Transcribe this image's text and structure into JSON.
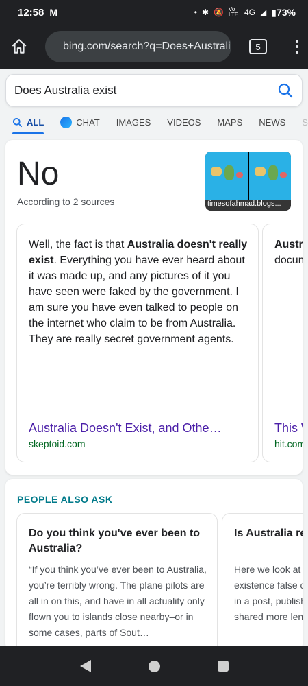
{
  "status_bar": {
    "time": "12:58",
    "notification_icon": "M",
    "network": "4G",
    "volte": "Vo LTE",
    "battery": "73%"
  },
  "browser": {
    "url": "bing.com/search?q=Does+Australia+exist",
    "tab_count": "5"
  },
  "search": {
    "query": "Does Australia exist"
  },
  "scopes": [
    {
      "label": "ALL",
      "active": true
    },
    {
      "label": "CHAT",
      "active": false
    },
    {
      "label": "IMAGES",
      "active": false
    },
    {
      "label": "VIDEOS",
      "active": false
    },
    {
      "label": "MAPS",
      "active": false
    },
    {
      "label": "NEWS",
      "active": false
    },
    {
      "label": "SH",
      "active": false
    }
  ],
  "answer": {
    "headline": "No",
    "subtitle": "According to 2 sources",
    "thumbnail_caption": "timesofahmad.blogs...",
    "snippets": [
      {
        "text_before": "Well, the fact is that ",
        "bold": "Australia doesn't really exist",
        "text_after": ". Everything you have ever heard about it was made up, and any pictures of it you have seen were faked by the government. I am sure you have even talked to people on the internet who claim to be from Australia. They are really secret government agents.",
        "link": "Australia Doesn't Exist, and Othe…",
        "domain": "skeptoid.com"
      },
      {
        "text_before": "",
        "bold": "Australia",
        "text_after": " “proof” documents government",
        "link": "This W",
        "domain": "hit.com"
      }
    ]
  },
  "people_also_ask": {
    "title": "PEOPLE ALSO ASK",
    "items": [
      {
        "question": "Do you think you've ever been to Australia?",
        "answer": "“If you think you’ve ever been to Australia, you’re terribly wrong. The plane pilots are all in on this, and have in all actuality only flown you to islands close nearby–or in some cases, parts of Sout…"
      },
      {
        "question": "Is Australia real?",
        "answer": "Here we look at Australia's existence false claim appeared in a post, published on been shared more lengthy caption l"
      }
    ]
  }
}
